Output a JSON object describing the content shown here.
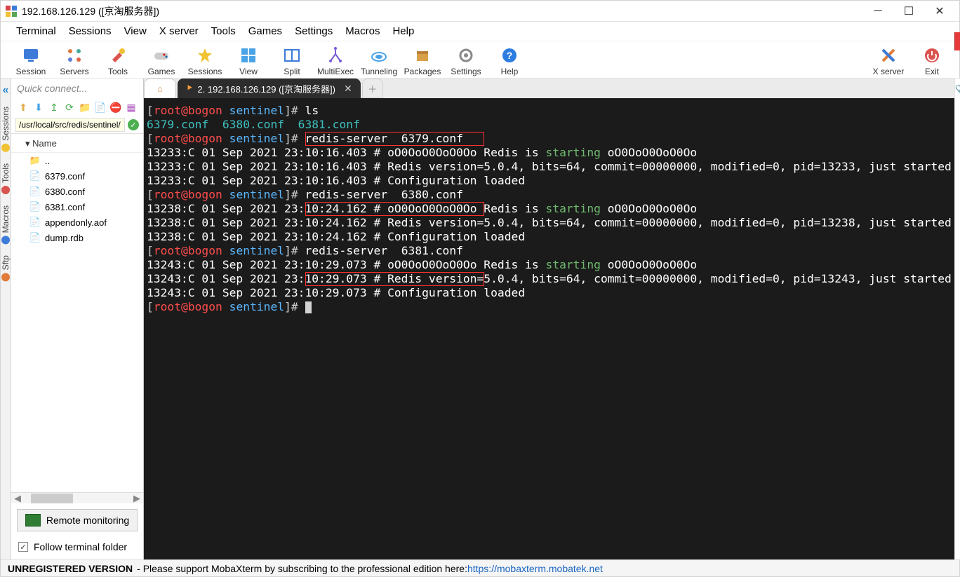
{
  "title": "192.168.126.129 ([京淘服务器])",
  "menu": [
    "Terminal",
    "Sessions",
    "View",
    "X server",
    "Tools",
    "Games",
    "Settings",
    "Macros",
    "Help"
  ],
  "toolbar": [
    {
      "label": "Session"
    },
    {
      "label": "Servers"
    },
    {
      "label": "Tools"
    },
    {
      "label": "Games"
    },
    {
      "label": "Sessions"
    },
    {
      "label": "View"
    },
    {
      "label": "Split"
    },
    {
      "label": "MultiExec"
    },
    {
      "label": "Tunneling"
    },
    {
      "label": "Packages"
    },
    {
      "label": "Settings"
    },
    {
      "label": "Help"
    }
  ],
  "toolbar_right": [
    {
      "label": "X server"
    },
    {
      "label": "Exit"
    }
  ],
  "vtabs": [
    "Sessions",
    "Tools",
    "Macros",
    "Sftp"
  ],
  "quickconnect_placeholder": "Quick connect...",
  "path": "/usr/local/src/redis/sentinel/",
  "file_header": "Name",
  "files": [
    {
      "icon": "fold",
      "name": ".."
    },
    {
      "icon": "conf",
      "name": "6379.conf"
    },
    {
      "icon": "conf",
      "name": "6380.conf"
    },
    {
      "icon": "conf",
      "name": "6381.conf"
    },
    {
      "icon": "file",
      "name": "appendonly.aof"
    },
    {
      "icon": "file",
      "name": "dump.rdb"
    }
  ],
  "remote_monitoring_label": "Remote monitoring",
  "follow_terminal_label": "Follow terminal folder",
  "tabs": {
    "active_label": "2.  192.168.126.129 ([京淘服务器])"
  },
  "term": {
    "prompt_userhost": "root@bogon",
    "prompt_dir": "sentinel",
    "cmd_ls": "ls",
    "ls_out": "6379.conf  6380.conf  6381.conf",
    "cmd1": "redis-server  6379.conf",
    "c1_l1": "13233:C 01 Sep 2021 23:10:16.403 # oO0OoO0OoO0Oo Redis is ",
    "c1_l1b": " oO0OoO0OoO0Oo",
    "c1_l2": "13233:C 01 Sep 2021 23:10:16.403 # Redis version=5.0.4, bits=64, commit=00000000, modified=0, pid=13233, just started",
    "c1_l3": "13233:C 01 Sep 2021 23:10:16.403 # Configuration loaded",
    "cmd2": "redis-server  6380.conf",
    "c2_l1": "13238:C 01 Sep 2021 23:10:24.162 # oO0OoO0OoO0Oo Redis is ",
    "c2_l1b": " oO0OoO0OoO0Oo",
    "c2_l2": "13238:C 01 Sep 2021 23:10:24.162 # Redis version=5.0.4, bits=64, commit=00000000, modified=0, pid=13238, just started",
    "c2_l3": "13238:C 01 Sep 2021 23:10:24.162 # Configuration loaded",
    "cmd3": "redis-server  6381.conf",
    "c3_l1": "13243:C 01 Sep 2021 23:10:29.073 # oO0OoO0OoO0Oo Redis is ",
    "c3_l1b": " oO0OoO0OoO0Oo",
    "c3_l2": "13243:C 01 Sep 2021 23:10:29.073 # Redis version=5.0.4, bits=64, commit=00000000, modified=0, pid=13243, just started",
    "c3_l3": "13243:C 01 Sep 2021 23:10:29.073 # Configuration loaded",
    "starting_word": "starting"
  },
  "status": {
    "unreg": "UNREGISTERED VERSION",
    "text": " -  Please support MobaXterm by subscribing to the professional edition here:  ",
    "url": "https://mobaxterm.mobatek.net"
  }
}
